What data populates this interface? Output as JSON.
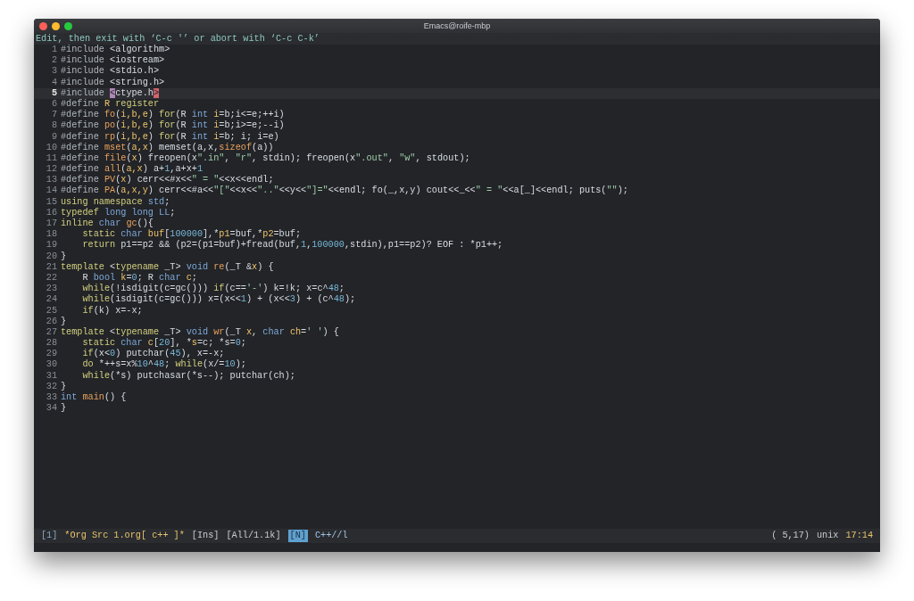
{
  "window": {
    "title": "Emacs@roife-mbp"
  },
  "message": "Edit, then exit with ‘C-c '’ or abort with ‘C-c C-k’",
  "lines": [
    {
      "number": "1",
      "current": false,
      "tokens": [
        {
          "text": "#include",
          "kind": "preproc"
        },
        {
          "text": " <algorithm>",
          "kind": "plain"
        }
      ]
    },
    {
      "number": "2",
      "current": false,
      "tokens": [
        {
          "text": "#include",
          "kind": "preproc"
        },
        {
          "text": " <iostream>",
          "kind": "plain"
        }
      ]
    },
    {
      "number": "3",
      "current": false,
      "tokens": [
        {
          "text": "#include",
          "kind": "preproc"
        },
        {
          "text": " <stdio.h>",
          "kind": "plain"
        }
      ]
    },
    {
      "number": "4",
      "current": false,
      "tokens": [
        {
          "text": "#include",
          "kind": "preproc"
        },
        {
          "text": " <string.h>",
          "kind": "plain"
        }
      ]
    },
    {
      "number": "5",
      "current": true,
      "tokens": [
        {
          "text": "#include ",
          "kind": "preproc"
        },
        {
          "text": "<",
          "kind": "cursor"
        },
        {
          "text": "ctype.h",
          "kind": "plain"
        },
        {
          "text": ">",
          "kind": "match"
        }
      ]
    },
    {
      "number": "6",
      "current": false,
      "tokens": [
        {
          "text": "#define ",
          "kind": "preproc"
        },
        {
          "text": "R",
          "kind": "var"
        },
        {
          "text": " register",
          "kind": "keyword"
        }
      ]
    },
    {
      "number": "7",
      "current": false,
      "tokens": [
        {
          "text": "#define ",
          "kind": "preproc"
        },
        {
          "text": "fo",
          "kind": "func"
        },
        {
          "text": "(",
          "kind": "plain"
        },
        {
          "text": "i,b,e",
          "kind": "var"
        },
        {
          "text": ") ",
          "kind": "plain"
        },
        {
          "text": "for",
          "kind": "keyword"
        },
        {
          "text": "(R ",
          "kind": "plain"
        },
        {
          "text": "int",
          "kind": "type"
        },
        {
          "text": " i",
          "kind": "var"
        },
        {
          "text": "=b;i<=e;++i)",
          "kind": "plain"
        }
      ]
    },
    {
      "number": "8",
      "current": false,
      "tokens": [
        {
          "text": "#define ",
          "kind": "preproc"
        },
        {
          "text": "po",
          "kind": "func"
        },
        {
          "text": "(",
          "kind": "plain"
        },
        {
          "text": "i,b,e",
          "kind": "var"
        },
        {
          "text": ") ",
          "kind": "plain"
        },
        {
          "text": "for",
          "kind": "keyword"
        },
        {
          "text": "(R ",
          "kind": "plain"
        },
        {
          "text": "int",
          "kind": "type"
        },
        {
          "text": " i",
          "kind": "var"
        },
        {
          "text": "=b;i>=e;--i)",
          "kind": "plain"
        }
      ]
    },
    {
      "number": "9",
      "current": false,
      "tokens": [
        {
          "text": "#define ",
          "kind": "preproc"
        },
        {
          "text": "rp",
          "kind": "func"
        },
        {
          "text": "(",
          "kind": "plain"
        },
        {
          "text": "i,b,e",
          "kind": "var"
        },
        {
          "text": ") ",
          "kind": "plain"
        },
        {
          "text": "for",
          "kind": "keyword"
        },
        {
          "text": "(R ",
          "kind": "plain"
        },
        {
          "text": "int",
          "kind": "type"
        },
        {
          "text": " i",
          "kind": "var"
        },
        {
          "text": "=b; i; i=e)",
          "kind": "plain"
        }
      ]
    },
    {
      "number": "10",
      "current": false,
      "tokens": [
        {
          "text": "#define ",
          "kind": "preproc"
        },
        {
          "text": "mset",
          "kind": "func"
        },
        {
          "text": "(",
          "kind": "plain"
        },
        {
          "text": "a,x",
          "kind": "var"
        },
        {
          "text": ") memset(a,x,",
          "kind": "plain"
        },
        {
          "text": "sizeof",
          "kind": "func"
        },
        {
          "text": "(a))",
          "kind": "plain"
        }
      ]
    },
    {
      "number": "11",
      "current": false,
      "tokens": [
        {
          "text": "#define ",
          "kind": "preproc"
        },
        {
          "text": "file",
          "kind": "func"
        },
        {
          "text": "(",
          "kind": "plain"
        },
        {
          "text": "x",
          "kind": "var"
        },
        {
          "text": ") freopen(x",
          "kind": "plain"
        },
        {
          "text": "\".in\"",
          "kind": "string"
        },
        {
          "text": ", ",
          "kind": "plain"
        },
        {
          "text": "\"r\"",
          "kind": "string"
        },
        {
          "text": ", stdin); freopen(x",
          "kind": "plain"
        },
        {
          "text": "\".out\"",
          "kind": "string"
        },
        {
          "text": ", ",
          "kind": "plain"
        },
        {
          "text": "\"w\"",
          "kind": "string"
        },
        {
          "text": ", stdout);",
          "kind": "plain"
        }
      ]
    },
    {
      "number": "12",
      "current": false,
      "tokens": [
        {
          "text": "#define ",
          "kind": "preproc"
        },
        {
          "text": "all",
          "kind": "func"
        },
        {
          "text": "(",
          "kind": "plain"
        },
        {
          "text": "a,x",
          "kind": "var"
        },
        {
          "text": ") a+",
          "kind": "plain"
        },
        {
          "text": "1",
          "kind": "number"
        },
        {
          "text": ",a+x+",
          "kind": "plain"
        },
        {
          "text": "1",
          "kind": "number"
        }
      ]
    },
    {
      "number": "13",
      "current": false,
      "tokens": [
        {
          "text": "#define ",
          "kind": "preproc"
        },
        {
          "text": "PV",
          "kind": "func"
        },
        {
          "text": "(",
          "kind": "plain"
        },
        {
          "text": "x",
          "kind": "var"
        },
        {
          "text": ") cerr<<#x<<",
          "kind": "plain"
        },
        {
          "text": "\" = \"",
          "kind": "string"
        },
        {
          "text": "<<x<<endl;",
          "kind": "plain"
        }
      ]
    },
    {
      "number": "14",
      "current": false,
      "tokens": [
        {
          "text": "#define ",
          "kind": "preproc"
        },
        {
          "text": "PA",
          "kind": "func"
        },
        {
          "text": "(",
          "kind": "plain"
        },
        {
          "text": "a,x,y",
          "kind": "var"
        },
        {
          "text": ") cerr<<#a<<",
          "kind": "plain"
        },
        {
          "text": "\"[\"",
          "kind": "string"
        },
        {
          "text": "<<x<<",
          "kind": "plain"
        },
        {
          "text": "\"..\"",
          "kind": "string"
        },
        {
          "text": "<<y<<",
          "kind": "plain"
        },
        {
          "text": "\"]=\"",
          "kind": "string"
        },
        {
          "text": "<<endl; fo(_,x,y) cout<<_<<",
          "kind": "plain"
        },
        {
          "text": "\" = \"",
          "kind": "string"
        },
        {
          "text": "<<a[_]<<endl; puts(",
          "kind": "plain"
        },
        {
          "text": "\"\"",
          "kind": "string"
        },
        {
          "text": ");",
          "kind": "plain"
        }
      ]
    },
    {
      "number": "15",
      "current": false,
      "tokens": [
        {
          "text": "using namespace",
          "kind": "keyword"
        },
        {
          "text": " std",
          "kind": "type"
        },
        {
          "text": ";",
          "kind": "plain"
        }
      ]
    },
    {
      "number": "16",
      "current": false,
      "tokens": [
        {
          "text": "typedef",
          "kind": "keyword"
        },
        {
          "text": " long long",
          "kind": "type"
        },
        {
          "text": " LL",
          "kind": "type"
        },
        {
          "text": ";",
          "kind": "plain"
        }
      ]
    },
    {
      "number": "17",
      "current": false,
      "tokens": [
        {
          "text": "inline",
          "kind": "keyword"
        },
        {
          "text": " char",
          "kind": "type"
        },
        {
          "text": " gc",
          "kind": "func"
        },
        {
          "text": "(){",
          "kind": "plain"
        }
      ]
    },
    {
      "number": "18",
      "current": false,
      "tokens": [
        {
          "text": "    static",
          "kind": "keyword"
        },
        {
          "text": " char",
          "kind": "type"
        },
        {
          "text": " buf",
          "kind": "var"
        },
        {
          "text": "[",
          "kind": "plain"
        },
        {
          "text": "100000",
          "kind": "number"
        },
        {
          "text": "],*",
          "kind": "plain"
        },
        {
          "text": "p1",
          "kind": "var"
        },
        {
          "text": "=buf,*",
          "kind": "plain"
        },
        {
          "text": "p2",
          "kind": "var"
        },
        {
          "text": "=buf;",
          "kind": "plain"
        }
      ]
    },
    {
      "number": "19",
      "current": false,
      "tokens": [
        {
          "text": "    return",
          "kind": "keyword"
        },
        {
          "text": " p1==p2 && (p2=(p1=buf)+fread(buf,",
          "kind": "plain"
        },
        {
          "text": "1",
          "kind": "number"
        },
        {
          "text": ",",
          "kind": "plain"
        },
        {
          "text": "100000",
          "kind": "number"
        },
        {
          "text": ",stdin),p1==p2)? EOF : *p1++;",
          "kind": "plain"
        }
      ]
    },
    {
      "number": "20",
      "current": false,
      "tokens": [
        {
          "text": "}",
          "kind": "plain"
        }
      ]
    },
    {
      "number": "21",
      "current": false,
      "tokens": [
        {
          "text": "template",
          "kind": "keyword"
        },
        {
          "text": " <",
          "kind": "plain"
        },
        {
          "text": "typename",
          "kind": "keyword"
        },
        {
          "text": " _T> ",
          "kind": "plain"
        },
        {
          "text": "void",
          "kind": "type"
        },
        {
          "text": " re",
          "kind": "func"
        },
        {
          "text": "(_T &",
          "kind": "plain"
        },
        {
          "text": "x",
          "kind": "var"
        },
        {
          "text": ") {",
          "kind": "plain"
        }
      ]
    },
    {
      "number": "22",
      "current": false,
      "tokens": [
        {
          "text": "    R ",
          "kind": "plain"
        },
        {
          "text": "bool",
          "kind": "type"
        },
        {
          "text": " k",
          "kind": "var"
        },
        {
          "text": "=",
          "kind": "plain"
        },
        {
          "text": "0",
          "kind": "number"
        },
        {
          "text": "; R ",
          "kind": "plain"
        },
        {
          "text": "char",
          "kind": "type"
        },
        {
          "text": " c",
          "kind": "var"
        },
        {
          "text": ";",
          "kind": "plain"
        }
      ]
    },
    {
      "number": "23",
      "current": false,
      "tokens": [
        {
          "text": "    while",
          "kind": "keyword"
        },
        {
          "text": "(!isdigit(c=gc())) ",
          "kind": "plain"
        },
        {
          "text": "if",
          "kind": "keyword"
        },
        {
          "text": "(c==",
          "kind": "plain"
        },
        {
          "text": "'-'",
          "kind": "string"
        },
        {
          "text": ") k=!k; x=c^",
          "kind": "plain"
        },
        {
          "text": "48",
          "kind": "number"
        },
        {
          "text": ";",
          "kind": "plain"
        }
      ]
    },
    {
      "number": "24",
      "current": false,
      "tokens": [
        {
          "text": "    while",
          "kind": "keyword"
        },
        {
          "text": "(isdigit(c=gc())) x=(x<<",
          "kind": "plain"
        },
        {
          "text": "1",
          "kind": "number"
        },
        {
          "text": ") + (x<<",
          "kind": "plain"
        },
        {
          "text": "3",
          "kind": "number"
        },
        {
          "text": ") + (c^",
          "kind": "plain"
        },
        {
          "text": "48",
          "kind": "number"
        },
        {
          "text": ");",
          "kind": "plain"
        }
      ]
    },
    {
      "number": "25",
      "current": false,
      "tokens": [
        {
          "text": "    if",
          "kind": "keyword"
        },
        {
          "text": "(k) x=-x;",
          "kind": "plain"
        }
      ]
    },
    {
      "number": "26",
      "current": false,
      "tokens": [
        {
          "text": "}",
          "kind": "plain"
        }
      ]
    },
    {
      "number": "27",
      "current": false,
      "tokens": [
        {
          "text": "template",
          "kind": "keyword"
        },
        {
          "text": " <",
          "kind": "plain"
        },
        {
          "text": "typename",
          "kind": "keyword"
        },
        {
          "text": " _T> ",
          "kind": "plain"
        },
        {
          "text": "void",
          "kind": "type"
        },
        {
          "text": " wr",
          "kind": "func"
        },
        {
          "text": "(_T ",
          "kind": "plain"
        },
        {
          "text": "x",
          "kind": "var"
        },
        {
          "text": ", ",
          "kind": "plain"
        },
        {
          "text": "char",
          "kind": "type"
        },
        {
          "text": " ch",
          "kind": "var"
        },
        {
          "text": "=",
          "kind": "plain"
        },
        {
          "text": "' '",
          "kind": "string"
        },
        {
          "text": ") {",
          "kind": "plain"
        }
      ]
    },
    {
      "number": "28",
      "current": false,
      "tokens": [
        {
          "text": "    static",
          "kind": "keyword"
        },
        {
          "text": " char",
          "kind": "type"
        },
        {
          "text": " c",
          "kind": "var"
        },
        {
          "text": "[",
          "kind": "plain"
        },
        {
          "text": "20",
          "kind": "number"
        },
        {
          "text": "], *",
          "kind": "plain"
        },
        {
          "text": "s",
          "kind": "var"
        },
        {
          "text": "=c; *s=",
          "kind": "plain"
        },
        {
          "text": "0",
          "kind": "number"
        },
        {
          "text": ";",
          "kind": "plain"
        }
      ]
    },
    {
      "number": "29",
      "current": false,
      "tokens": [
        {
          "text": "    if",
          "kind": "keyword"
        },
        {
          "text": "(x<",
          "kind": "plain"
        },
        {
          "text": "0",
          "kind": "number"
        },
        {
          "text": ") putchar(",
          "kind": "plain"
        },
        {
          "text": "45",
          "kind": "number"
        },
        {
          "text": "), x=-x;",
          "kind": "plain"
        }
      ]
    },
    {
      "number": "30",
      "current": false,
      "tokens": [
        {
          "text": "    do",
          "kind": "keyword"
        },
        {
          "text": " *++s=x%",
          "kind": "plain"
        },
        {
          "text": "10",
          "kind": "number"
        },
        {
          "text": "^",
          "kind": "plain"
        },
        {
          "text": "48",
          "kind": "number"
        },
        {
          "text": "; ",
          "kind": "plain"
        },
        {
          "text": "while",
          "kind": "keyword"
        },
        {
          "text": "(x/=",
          "kind": "plain"
        },
        {
          "text": "10",
          "kind": "number"
        },
        {
          "text": ");",
          "kind": "plain"
        }
      ]
    },
    {
      "number": "31",
      "current": false,
      "tokens": [
        {
          "text": "    while",
          "kind": "keyword"
        },
        {
          "text": "(*s) putchasar(*s--); putchar(ch);",
          "kind": "plain"
        }
      ]
    },
    {
      "number": "32",
      "current": false,
      "tokens": [
        {
          "text": "}",
          "kind": "plain"
        }
      ]
    },
    {
      "number": "33",
      "current": false,
      "tokens": [
        {
          "text": "int",
          "kind": "type"
        },
        {
          "text": " main",
          "kind": "func"
        },
        {
          "text": "() {",
          "kind": "plain"
        }
      ]
    },
    {
      "number": "34",
      "current": false,
      "tokens": [
        {
          "text": "}",
          "kind": "plain"
        }
      ]
    }
  ],
  "mode_line": {
    "left": [
      {
        "text": "[1]",
        "kind": "window"
      },
      {
        "text": "*Org Src 1.org[ c++ ]*",
        "kind": "buffer"
      },
      {
        "text": "[Ins]",
        "kind": "plain"
      },
      {
        "text": "[All/1.1k]",
        "kind": "plain"
      },
      {
        "text": "[N]",
        "kind": "state"
      },
      {
        "text": "C++//l",
        "kind": "mode"
      }
    ],
    "right": [
      {
        "text": "( 5,17)",
        "kind": "plain"
      },
      {
        "text": "unix",
        "kind": "plain"
      },
      {
        "text": "17:14",
        "kind": "buffer"
      }
    ]
  }
}
